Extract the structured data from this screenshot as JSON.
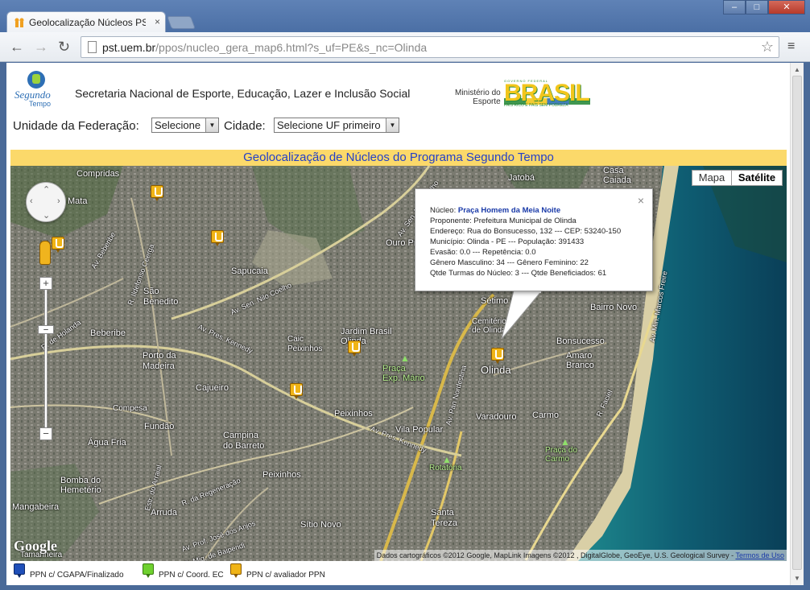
{
  "browser": {
    "tab_title": "Geolocalização Núcleos PS",
    "tab_close": "×",
    "url_host": "pst.uem.br",
    "url_path": "/ppos/nucleo_gera_map6.html?s_uf=PE&s_nc=Olinda",
    "back_icon": "←",
    "forward_icon": "→",
    "reload_icon": "↻",
    "star_icon": "☆",
    "menu_icon": "≡"
  },
  "header": {
    "logo_text": "Segundo",
    "logo_subtext": "Tempo",
    "title": "Secretaria Nacional de Esporte, Educação, Lazer e Inclusão Social",
    "ministerio": "Ministério do",
    "ministerio2": "Esporte",
    "brasil_top": "GOVERNO FEDERAL",
    "brasil_word": "BRASIL",
    "brasil_bottom": "PAÍS RICO É PAÍS SEM POBREZA"
  },
  "filters": {
    "uf_label": "Unidade da Federação:",
    "uf_selected": "Selecione",
    "city_label": "Cidade:",
    "city_selected": "Selecione UF primeiro"
  },
  "banner": "Geolocalização de Núcleos do Programa Segundo Tempo",
  "map": {
    "type_buttons": [
      "Mapa",
      "Satélite"
    ],
    "active_type": "Satélite",
    "google": "Google",
    "attribution": "Dados cartográficos ©2012 Google, MapLink Imagens ©2012 , DigitalGlobe, GeoEye, U.S. Geological Survey - ",
    "terms": "Termos de Uso",
    "places": {
      "compridas": "Compridas",
      "jatoba": "Jatobá",
      "casa_caiada": "Casa\nCaiada",
      "mata": "Mata",
      "ouro_preto": "Ouro Pr",
      "sapucaia": "Sapucaia",
      "sao_benedito": "São\nBenedito",
      "setimo_ro": "Sétimo Ro",
      "bairro_novo": "Bairro Novo",
      "cemiterio": "Cemitério\nde Olinda",
      "bonsucesso": "Bonsucesso",
      "beberibe": "Beberibe",
      "caic": "Caic\nPeixinhos",
      "jardim_brasil": "Jardim Brasil\nOlinda",
      "praca_exp": "Praça\nExp. Mário",
      "olinda": "Olinda",
      "amaro_branco": "Amaro\nBranco",
      "porto_madeira": "Porto da\nMadeira",
      "cajueiro": "Cajueiro",
      "peixinhos": "Peixinhos",
      "varadouro": "Varadouro",
      "carmo": "Carmo",
      "compesa": "Compesa",
      "fundao": "Fundão",
      "campina": "Campina\ndo Barreto",
      "vila_popular": "Vila Popular",
      "agua_fria": "Água Fria",
      "praca_carmo": "Praça do\nCarmo",
      "rotatoria": "Rotatória",
      "bomba": "Bomba do\nHemetério",
      "peixinhos2": "Peixinhos",
      "mangabeira": "Mangabeira",
      "arruda": "Arruda",
      "santa_tereza": "Santa\nTereza",
      "sitio_novo": "Sítio Novo",
      "tamarineira": "Tamarineira"
    },
    "roads": {
      "r1": "Av. Sen. Nilo Coelho",
      "r2": "Av. Pres. Kennedy",
      "r3": "Av. Pres. Kennedy",
      "r4": "Av. Pan Nordestina",
      "r5": "R. da Regeneração",
      "r6": "Estr. do Arraial",
      "r7": "Av. Prof. José dos Anjos",
      "r8": "R. Mig. de Baipendi",
      "r9": "R. de Holanda",
      "r10": "Av. Beberibe",
      "r11": "Av. Min. Marcos Freire",
      "r12": "Av. Sen. Nilo Coelho",
      "r13": "R. Ildefonso Ceerga",
      "r14": "R. Faciel"
    },
    "infowindow": {
      "close": "×",
      "nucleo_label": "Núcleo: ",
      "nucleo_name": "Praça Homem da Meia Noite",
      "proponente": "Proponente: Prefeitura Municipal de Olinda",
      "endereco": "Endereço: Rua do Bonsucesso, 132 --- CEP: 53240-150",
      "municipio": "Município: Olinda - PE --- População: 391433",
      "evasao": "Evasão: 0.0 --- Repetência: 0.0",
      "genero": "Gênero Masculino: 34 --- Gênero Feminino: 22",
      "turmas": "Qtde Turmas do Núcleo: 3 --- Qtde Beneficiados: 61"
    }
  },
  "legend": [
    {
      "label": "PPN c/ CGAPA/Finalizado",
      "color": "#1f4fb8"
    },
    {
      "label": "PPN c/ Coord. EC",
      "color": "#6fd12f"
    },
    {
      "label": "PPN c/ avaliador PPN",
      "color": "#f0b416"
    }
  ]
}
